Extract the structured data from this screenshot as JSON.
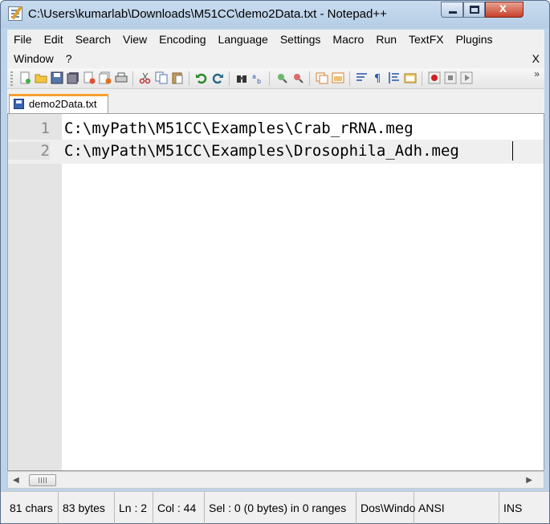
{
  "window": {
    "title": "C:\\Users\\kumarlab\\Downloads\\M51CC\\demo2Data.txt - Notepad++",
    "close_glyph": "x"
  },
  "menu": {
    "row1": [
      "File",
      "Edit",
      "Search",
      "View",
      "Encoding",
      "Language",
      "Settings",
      "Macro",
      "Run",
      "TextFX",
      "Plugins"
    ],
    "row2": [
      "Window",
      "?"
    ],
    "close_label": "X"
  },
  "toolbar": {
    "icons": [
      "new-file-icon",
      "open-file-icon",
      "save-icon",
      "save-all-icon",
      "close-icon",
      "close-all-icon",
      "print-icon",
      "cut-icon",
      "copy-icon",
      "paste-icon",
      "undo-icon",
      "redo-icon",
      "find-icon",
      "replace-icon",
      "zoom-in-icon",
      "zoom-out-icon",
      "sync-vertical-icon",
      "sync-horizontal-icon",
      "word-wrap-icon",
      "show-all-chars-icon",
      "indent-guide-icon",
      "folder-icon",
      "record-macro-icon",
      "stop-macro-icon",
      "play-macro-icon"
    ],
    "more_glyph": "»"
  },
  "tabs": [
    {
      "label": "demo2Data.txt",
      "active": true
    }
  ],
  "editor": {
    "lines": [
      {
        "number": "1",
        "text": "C:\\myPath\\M51CC\\Examples\\Crab_rRNA.meg"
      },
      {
        "number": "2",
        "text": "C:\\myPath\\M51CC\\Examples\\Drosophila_Adh.meg"
      }
    ],
    "current_line": 2
  },
  "status": {
    "chars": "81 chars",
    "bytes": "83 bytes",
    "line": "Ln : 2",
    "column": "Col : 44",
    "selection": "Sel : 0 (0 bytes) in 0 ranges",
    "eol": "Dos\\Windo",
    "encoding": "ANSI",
    "mode": "INS"
  },
  "colors": {
    "title_bar": "#bcd3ea",
    "active_tab_accent": "#f8a030",
    "gutter": "#e4e4e4",
    "current_line": "#efefef"
  }
}
